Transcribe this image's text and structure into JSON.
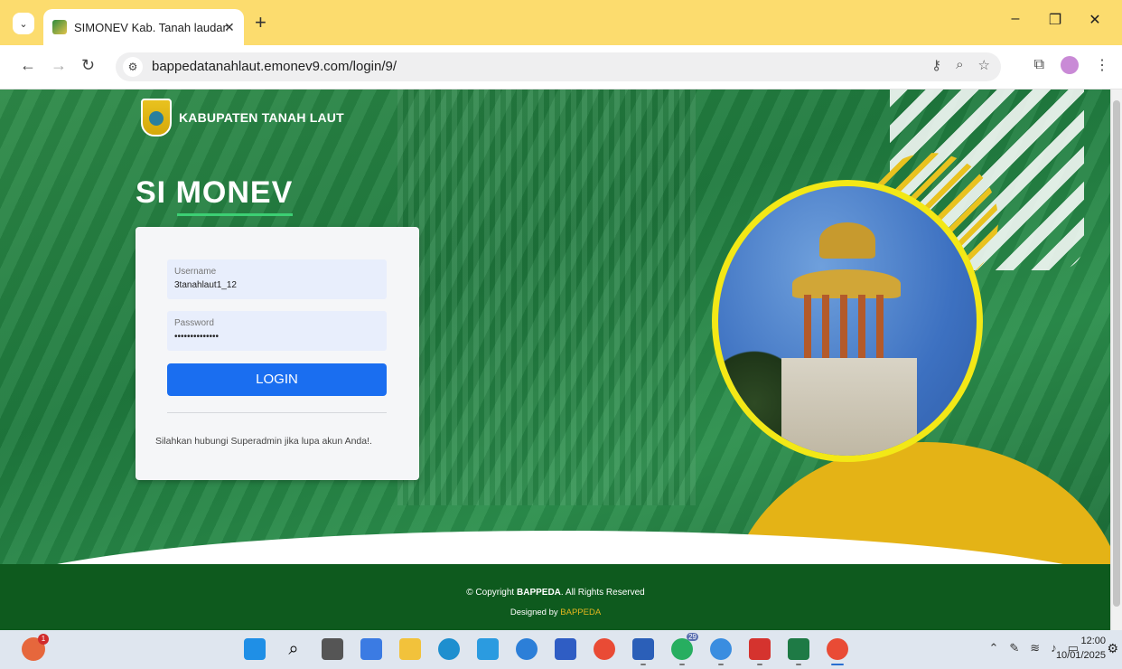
{
  "browser": {
    "tab_title": "SIMONEV Kab. Tanah laudantiu",
    "url": "bappedatanahlaut.emonev9.com/login/9/",
    "window_controls": [
      "–",
      "❐",
      "✕"
    ],
    "nav_icons": [
      "back-icon",
      "forward-icon",
      "reload-icon"
    ]
  },
  "page": {
    "brand_name": "KABUPATEN TANAH LAUT",
    "app_title": "SI MONEV",
    "login": {
      "username_label": "Username",
      "username_value": "3tanahlaut1_12",
      "password_label": "Password",
      "password_value": "••••••••••••••",
      "button_label": "LOGIN",
      "help_text": "Silahkan hubungi Superadmin jika lupa akun Anda!."
    },
    "footer": {
      "copyright_prefix": "© Copyright ",
      "copyright_brand": "BAPPEDA",
      "copyright_suffix": ". All Rights Reserved",
      "designed_prefix": "Designed by ",
      "designed_brand": "BAPPEDA"
    }
  },
  "taskbar": {
    "notification_count": "1",
    "whatsapp_badge": "29",
    "time": "12:00",
    "date": "10/01/2025"
  },
  "colors": {
    "hero_green": "#1f7a3e",
    "footer_green": "#0e5a1e",
    "accent_yellow": "#e4b316",
    "login_blue": "#1a6ef0",
    "tab_bar": "#fcdc6e"
  }
}
